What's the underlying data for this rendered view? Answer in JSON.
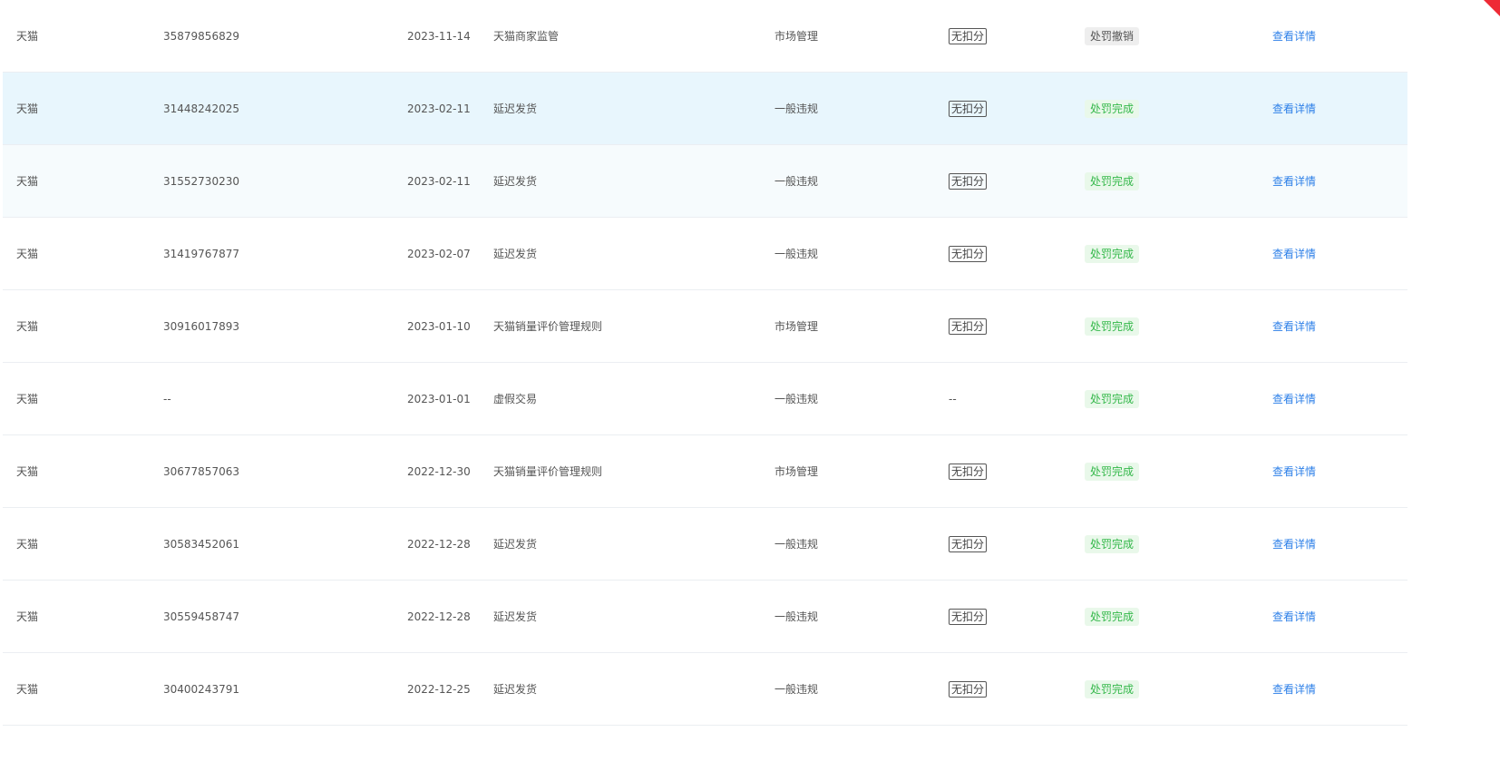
{
  "corner_color": "#ee2a35",
  "rows": [
    {
      "platform": "天猫",
      "id": "35879856829",
      "date": "2023-11-14",
      "reason": "天猫商家监管",
      "type": "市场管理",
      "score": "无扣分",
      "status": "处罚撤销",
      "status_kind": "revoked",
      "action": "查看详情"
    },
    {
      "platform": "天猫",
      "id": "31448242025",
      "date": "2023-02-11",
      "reason": "延迟发货",
      "type": "一般违规",
      "score": "无扣分",
      "status": "处罚完成",
      "status_kind": "done",
      "action": "查看详情"
    },
    {
      "platform": "天猫",
      "id": "31552730230",
      "date": "2023-02-11",
      "reason": "延迟发货",
      "type": "一般违规",
      "score": "无扣分",
      "status": "处罚完成",
      "status_kind": "done",
      "action": "查看详情"
    },
    {
      "platform": "天猫",
      "id": "31419767877",
      "date": "2023-02-07",
      "reason": "延迟发货",
      "type": "一般违规",
      "score": "无扣分",
      "status": "处罚完成",
      "status_kind": "done",
      "action": "查看详情"
    },
    {
      "platform": "天猫",
      "id": "30916017893",
      "date": "2023-01-10",
      "reason": "天猫销量评价管理规则",
      "type": "市场管理",
      "score": "无扣分",
      "status": "处罚完成",
      "status_kind": "done",
      "action": "查看详情"
    },
    {
      "platform": "天猫",
      "id": "--",
      "date": "2023-01-01",
      "reason": "虚假交易",
      "type": "一般违规",
      "score": "--",
      "status": "处罚完成",
      "status_kind": "done",
      "action": "查看详情"
    },
    {
      "platform": "天猫",
      "id": "30677857063",
      "date": "2022-12-30",
      "reason": "天猫销量评价管理规则",
      "type": "市场管理",
      "score": "无扣分",
      "status": "处罚完成",
      "status_kind": "done",
      "action": "查看详情"
    },
    {
      "platform": "天猫",
      "id": "30583452061",
      "date": "2022-12-28",
      "reason": "延迟发货",
      "type": "一般违规",
      "score": "无扣分",
      "status": "处罚完成",
      "status_kind": "done",
      "action": "查看详情"
    },
    {
      "platform": "天猫",
      "id": "30559458747",
      "date": "2022-12-28",
      "reason": "延迟发货",
      "type": "一般违规",
      "score": "无扣分",
      "status": "处罚完成",
      "status_kind": "done",
      "action": "查看详情"
    },
    {
      "platform": "天猫",
      "id": "30400243791",
      "date": "2022-12-25",
      "reason": "延迟发货",
      "type": "一般违规",
      "score": "无扣分",
      "status": "处罚完成",
      "status_kind": "done",
      "action": "查看详情"
    }
  ]
}
